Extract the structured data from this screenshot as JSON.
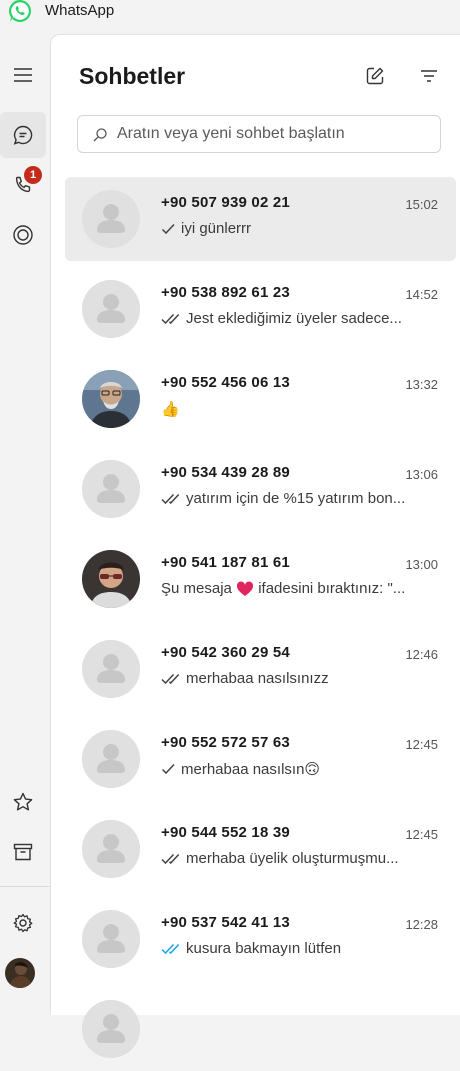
{
  "app": {
    "title": "WhatsApp"
  },
  "rail": {
    "calls_badge": "1"
  },
  "panel": {
    "title": "Sohbetler"
  },
  "search": {
    "placeholder": "Aratın veya yeni sohbet başlatın"
  },
  "colors": {
    "accent": "#25d366",
    "badge": "#c42b1c",
    "read_tick": "#1da1f2",
    "selected_bg": "#ebebeb"
  },
  "chats": [
    {
      "name": "+90 507 939 02 21",
      "time": "15:02",
      "tick": "single",
      "preview": "iyi günlerrr",
      "avatar": "default",
      "selected": true
    },
    {
      "name": "+90 538 892 61 23",
      "time": "14:52",
      "tick": "double",
      "preview": "Jest eklediğimiz üyeler sadece...",
      "avatar": "default"
    },
    {
      "name": "+90 552 456 06 13",
      "time": "13:32",
      "tick": "none",
      "preview": "👍",
      "avatar": "photo-older-man"
    },
    {
      "name": "+90 534 439 28 89",
      "time": "13:06",
      "tick": "double",
      "preview": "yatırım için de %15 yatırım bon...",
      "avatar": "default"
    },
    {
      "name": "+90 541 187 81 61",
      "time": "13:00",
      "tick": "none",
      "preview_before": "Şu mesaja",
      "preview_emoji": "❤️",
      "preview_after": "ifadesini bıraktınız: \"...",
      "avatar": "photo-young-man"
    },
    {
      "name": "+90 542 360 29 54",
      "time": "12:46",
      "tick": "double",
      "preview": "merhabaa nasılsınızz",
      "avatar": "default"
    },
    {
      "name": "+90 552 572 57 63",
      "time": "12:45",
      "tick": "single",
      "preview": "merhabaa nasılsın🙃",
      "avatar": "default"
    },
    {
      "name": "+90 544 552 18 39",
      "time": "12:45",
      "tick": "double",
      "preview": "merhaba üyelik oluşturmuşmu...",
      "avatar": "default"
    },
    {
      "name": "+90 537 542 41 13",
      "time": "12:28",
      "tick": "double-read",
      "preview": "kusura bakmayın lütfen",
      "avatar": "default"
    }
  ]
}
